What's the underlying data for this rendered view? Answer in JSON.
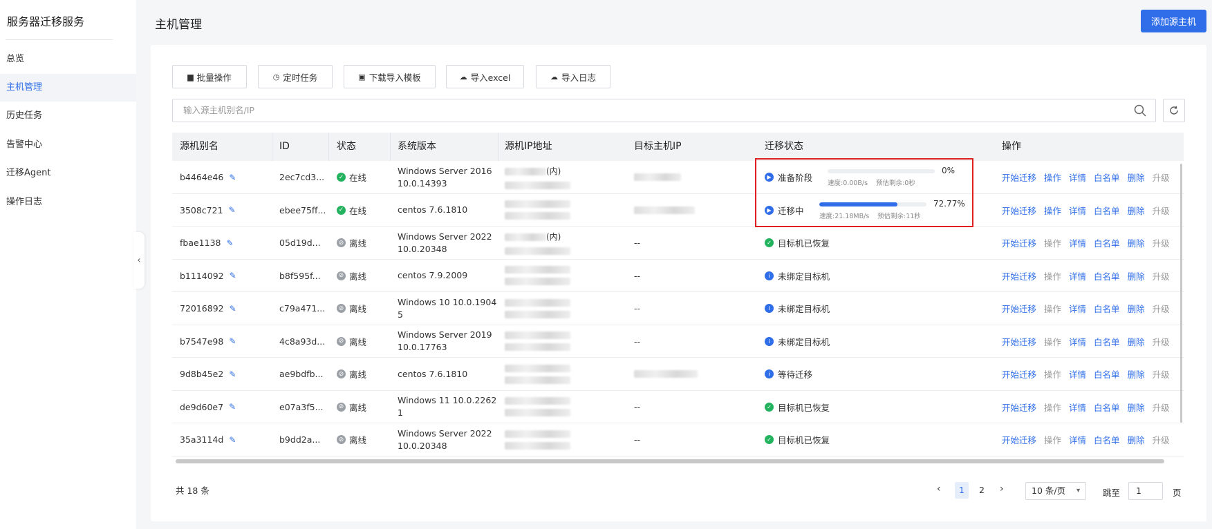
{
  "sidebar": {
    "title": "服务器迁移服务",
    "items": [
      {
        "label": "总览"
      },
      {
        "label": "主机管理"
      },
      {
        "label": "历史任务"
      },
      {
        "label": "告警中心"
      },
      {
        "label": "迁移Agent"
      },
      {
        "label": "操作日志"
      }
    ],
    "active_index": 1
  },
  "header": {
    "title": "主机管理",
    "add_button": "添加源主机"
  },
  "toolbar": {
    "batch": "批量操作",
    "schedule": "定时任务",
    "download_template": "下载导入模板",
    "import_excel": "导入excel",
    "import_log": "导入日志"
  },
  "search": {
    "placeholder": "输入源主机别名/IP"
  },
  "table": {
    "headers": [
      "源机别名",
      "ID",
      "状态",
      "系统版本",
      "源机IP地址",
      "目标主机IP",
      "迁移状态",
      "操作"
    ],
    "ops": [
      "开始迁移",
      "操作",
      "详情",
      "白名单",
      "删除",
      "升级"
    ],
    "rows": [
      {
        "alias": "b4464e46",
        "id": "2ec7cd3...",
        "status": "在线",
        "online": true,
        "os1": "Windows Server 2016",
        "os2": "10.0.14393",
        "ip1": "(内)",
        "has_target": true,
        "mig_type": "progress",
        "mig": "准备阶段",
        "pct": "0%",
        "progress": 0,
        "speed": "速度:0.00B/s",
        "remain": "预估剩余:0秒"
      },
      {
        "alias": "3508c721",
        "id": "ebee75ff...",
        "status": "在线",
        "online": true,
        "os1": "centos 7.6.1810",
        "os2": "",
        "ip1": "",
        "has_target": true,
        "mig_type": "progress",
        "mig": "迁移中",
        "pct": "72.77%",
        "progress": 0.7277,
        "speed": "速度:21.18MB/s",
        "remain": "预估剩余:11秒"
      },
      {
        "alias": "fbae1138",
        "id": "05d19d...",
        "status": "离线",
        "online": false,
        "os1": "Windows Server 2022",
        "os2": "10.0.20348",
        "ip1": "(内)",
        "has_target": false,
        "target": "--",
        "mig_type": "success",
        "mig": "目标机已恢复"
      },
      {
        "alias": "b1114092",
        "id": "b8f595f...",
        "status": "离线",
        "online": false,
        "os1": "centos 7.9.2009",
        "os2": "",
        "ip1": "",
        "has_target": false,
        "target": "--",
        "mig_type": "info",
        "mig": "未绑定目标机"
      },
      {
        "alias": "72016892",
        "id": "c79a471...",
        "status": "离线",
        "online": false,
        "os1": "Windows 10 10.0.1904",
        "os2": "5",
        "ip1": "",
        "has_target": false,
        "target": "--",
        "mig_type": "info",
        "mig": "未绑定目标机"
      },
      {
        "alias": "b7547e98",
        "id": "4c8a93d...",
        "status": "离线",
        "online": false,
        "os1": "Windows Server 2019",
        "os2": "10.0.17763",
        "ip1": "",
        "has_target": false,
        "target": "--",
        "mig_type": "info",
        "mig": "未绑定目标机"
      },
      {
        "alias": "9d8b45e2",
        "id": "ae9bdfb...",
        "status": "离线",
        "online": false,
        "os1": "centos 7.6.1810",
        "os2": "",
        "ip1": "",
        "has_target": true,
        "mig_type": "info",
        "mig": "等待迁移"
      },
      {
        "alias": "de9d60e7",
        "id": "e07a3f5...",
        "status": "离线",
        "online": false,
        "os1": "Windows 11 10.0.2262",
        "os2": "1",
        "ip1": "",
        "has_target": false,
        "target": "--",
        "mig_type": "success",
        "mig": "目标机已恢复"
      },
      {
        "alias": "35a3114d",
        "id": "b9dd2a...",
        "status": "离线",
        "online": false,
        "os1": "Windows Server 2022",
        "os2": "10.0.20348",
        "ip1": "",
        "has_target": false,
        "target": "--",
        "mig_type": "success",
        "mig": "目标机已恢复"
      }
    ]
  },
  "pagination": {
    "total": "共 18 条",
    "pages": [
      "1",
      "2"
    ],
    "active": "1",
    "page_size": "10 条/页",
    "jump_label": "跳至",
    "jump_value": "1",
    "page_suffix": "页"
  },
  "colors": {
    "accent": "#2f6ee8",
    "success": "#23b35f",
    "highlight_border": "#e02020"
  }
}
